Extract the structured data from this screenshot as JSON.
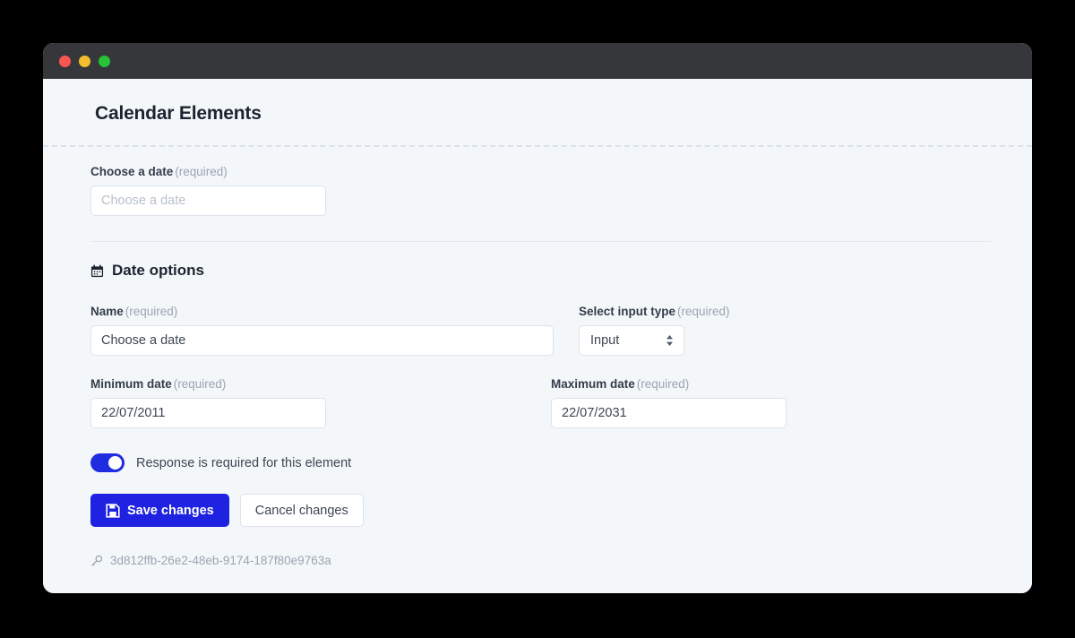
{
  "window": {
    "traffic_lights": [
      "close",
      "minimize",
      "maximize"
    ],
    "colors": {
      "titlebar": "#35373a",
      "close": "#f9564f",
      "minimize": "#f6bc2f",
      "maximize": "#25c335",
      "page_background": "#f4f7f9",
      "accent": "#1f22e0",
      "toggle_on": "#1f2ce0"
    }
  },
  "header": {
    "title": "Calendar Elements"
  },
  "preview": {
    "label": "Choose a date",
    "required_note": "(required)",
    "input_value": "",
    "input_placeholder": "Choose a date"
  },
  "options_section": {
    "icon": "calendar-icon",
    "title": "Date options",
    "name_field": {
      "label": "Name",
      "required_note": "(required)",
      "value": "Choose a date",
      "placeholder": "Choose a date"
    },
    "input_type_field": {
      "label": "Select input type",
      "required_note": "(required)",
      "selected": "Input",
      "options": [
        "Input"
      ]
    },
    "minimum_date_field": {
      "label": "Minimum date",
      "required_note": "(required)",
      "value": "22/07/2011",
      "placeholder": "22/07/2011"
    },
    "maximum_date_field": {
      "label": "Maximum date",
      "required_note": "(required)",
      "value": "22/07/2031",
      "placeholder": "22/07/2031"
    },
    "required_toggle": {
      "label": "Response is required for this element",
      "state": "on"
    },
    "save_button": {
      "label": "Save changes",
      "icon": "save-floppy-icon"
    },
    "cancel_button": {
      "label": "Cancel changes"
    }
  },
  "footer": {
    "icon": "key-icon",
    "element_id": "3d812ffb-26e2-48eb-9174-187f80e9763a"
  }
}
